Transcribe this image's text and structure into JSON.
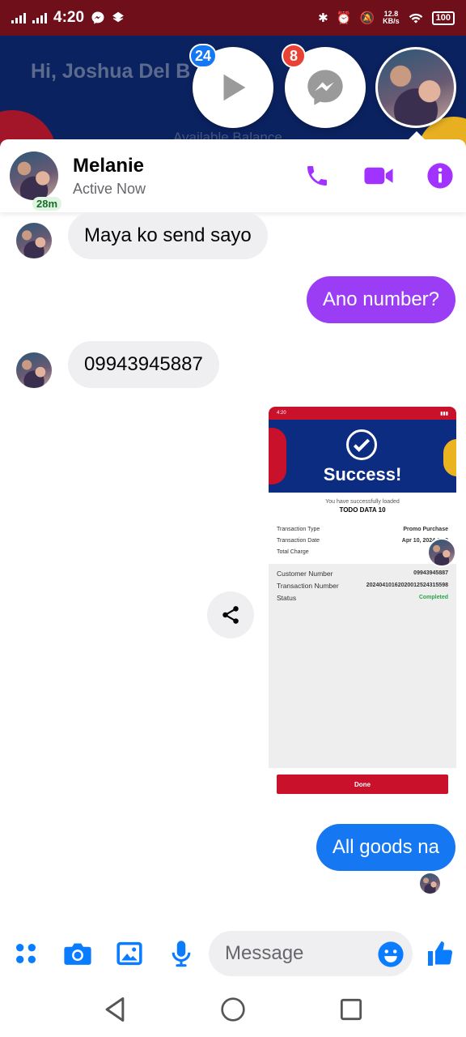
{
  "status_bar": {
    "time": "4:20",
    "net_speed_value": "12.8",
    "net_speed_unit": "KB/s",
    "battery": "100"
  },
  "background_app": {
    "greeting": "Hi, Joshua Del B",
    "balance_label": "Available Balance"
  },
  "chat_heads": {
    "video_badge": "24",
    "messenger_badge": "8"
  },
  "header": {
    "contact_name": "Melanie",
    "status": "Active Now",
    "last_active": "28m"
  },
  "messages": [
    {
      "direction": "incoming",
      "text": "Maya ko send sayo"
    },
    {
      "direction": "outgoing",
      "text": "Ano number?"
    },
    {
      "direction": "incoming",
      "text": "09943945887"
    },
    {
      "direction": "outgoing",
      "type": "image"
    },
    {
      "direction": "outgoing",
      "text": "All goods na"
    }
  ],
  "attachment": {
    "status_time": "4:20",
    "title": "Success!",
    "loaded_text": "You have successfully loaded",
    "product": "TODO DATA 10",
    "rows": [
      {
        "label": "Transaction Type",
        "value": "Promo Purchase"
      },
      {
        "label": "Transaction Date",
        "value": "Apr 10, 2024  16:2"
      },
      {
        "label": "Total Charge",
        "value": ""
      }
    ],
    "details": [
      {
        "label": "Customer Number",
        "value": "09943945887"
      },
      {
        "label": "Transaction Number",
        "value": "20240410162020012524315598"
      },
      {
        "label": "Status",
        "value": "Completed"
      }
    ],
    "done_label": "Done"
  },
  "composer": {
    "placeholder": "Message"
  },
  "colors": {
    "status_bar": "#6e0f1a",
    "messenger_purple": "#9b3df5",
    "messenger_blue": "#1677f2",
    "incoming_bubble": "#efeff1",
    "composer_icon_blue": "#0a7cff",
    "header_icon_purple": "#a033ff"
  }
}
